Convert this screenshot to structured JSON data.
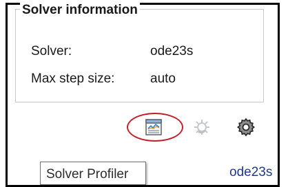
{
  "solver_info": {
    "title": "Solver information",
    "rows": [
      {
        "label": "Solver:",
        "value": "ode23s"
      },
      {
        "label": "Max step size:",
        "value": "auto"
      }
    ]
  },
  "toolbar": {
    "buttons": [
      {
        "icon": "solver-profiler-icon",
        "state": "highlighted"
      },
      {
        "icon": "gear-refresh-icon",
        "state": "disabled"
      },
      {
        "icon": "gear-icon",
        "state": "enabled"
      }
    ],
    "highlight_color": "#c0222b"
  },
  "tooltip": {
    "text": "Solver Profiler"
  },
  "bottom_value": {
    "text": "ode23s"
  }
}
